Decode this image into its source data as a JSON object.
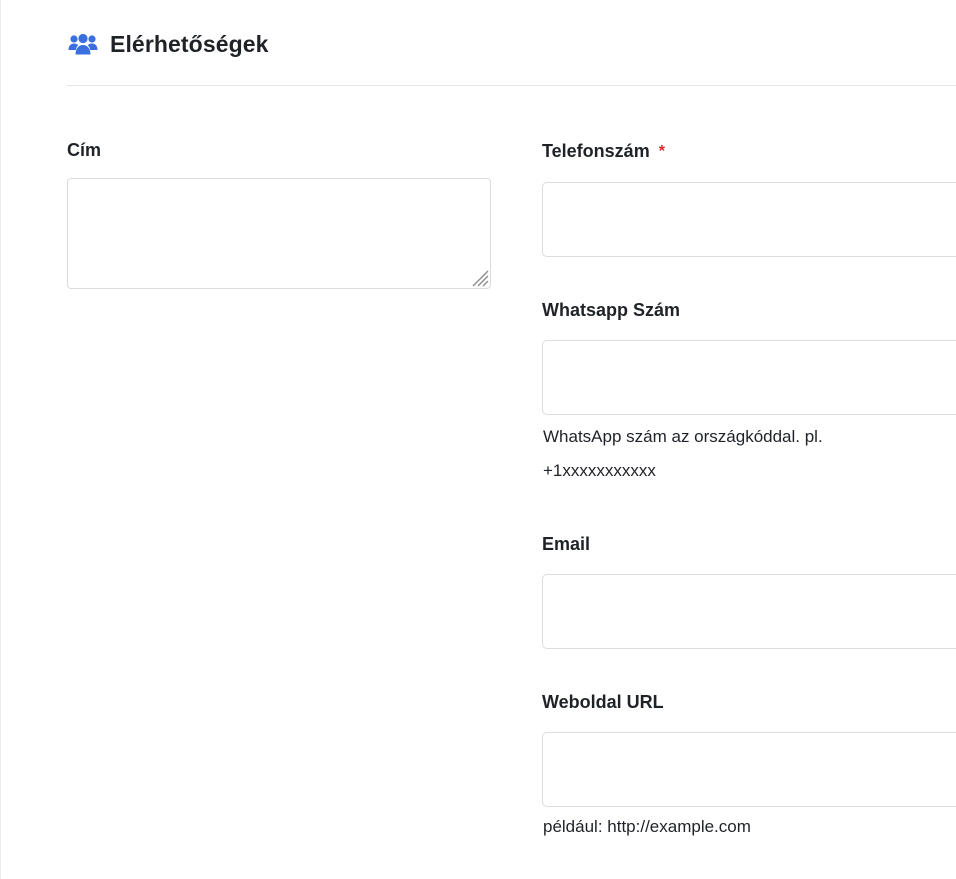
{
  "section": {
    "title": "Elérhetőségek",
    "icon": "users-icon",
    "icon_color": "#3a6fe0"
  },
  "fields": {
    "address": {
      "label": "Cím",
      "value": ""
    },
    "phone": {
      "label": "Telefonszám",
      "required_mark": "*",
      "value": ""
    },
    "whatsapp": {
      "label": "Whatsapp Szám",
      "value": "",
      "help_line1": "WhatsApp szám az országkóddal. pl.",
      "help_line2": "+1xxxxxxxxxxx"
    },
    "email": {
      "label": "Email",
      "value": ""
    },
    "website": {
      "label": "Weboldal URL",
      "value": "",
      "help": "például: http://example.com"
    }
  },
  "colors": {
    "required": "#e0262b",
    "border": "#dcdcdc",
    "text": "#1f2328"
  }
}
